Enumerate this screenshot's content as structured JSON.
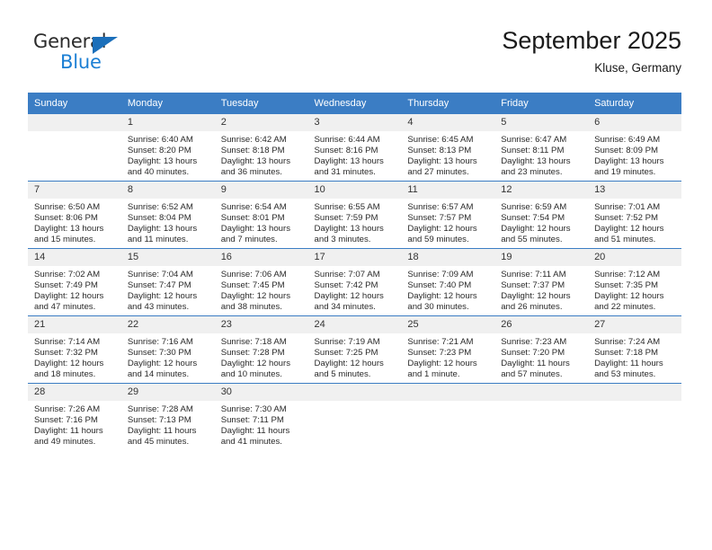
{
  "brand": {
    "name_part1": "General",
    "name_part2": "Blue",
    "accent_color": "#1b7fd4",
    "triangle_color": "#1b6fba"
  },
  "header": {
    "title": "September 2025",
    "subtitle": "Kluse, Germany",
    "header_bg": "#3b7dc4",
    "daynum_bg": "#f0f0f0"
  },
  "weekdays": [
    "Sunday",
    "Monday",
    "Tuesday",
    "Wednesday",
    "Thursday",
    "Friday",
    "Saturday"
  ],
  "labels": {
    "sunrise_prefix": "Sunrise:",
    "sunset_prefix": "Sunset:",
    "daylight_prefix": "Daylight:"
  },
  "weeks": [
    [
      {
        "day": "",
        "blank": true,
        "line1": "",
        "line2": "",
        "line3": "",
        "line4": ""
      },
      {
        "day": "1",
        "line1": "Sunrise: 6:40 AM",
        "line2": "Sunset: 8:20 PM",
        "line3": "Daylight: 13 hours",
        "line4": "and 40 minutes."
      },
      {
        "day": "2",
        "line1": "Sunrise: 6:42 AM",
        "line2": "Sunset: 8:18 PM",
        "line3": "Daylight: 13 hours",
        "line4": "and 36 minutes."
      },
      {
        "day": "3",
        "line1": "Sunrise: 6:44 AM",
        "line2": "Sunset: 8:16 PM",
        "line3": "Daylight: 13 hours",
        "line4": "and 31 minutes."
      },
      {
        "day": "4",
        "line1": "Sunrise: 6:45 AM",
        "line2": "Sunset: 8:13 PM",
        "line3": "Daylight: 13 hours",
        "line4": "and 27 minutes."
      },
      {
        "day": "5",
        "line1": "Sunrise: 6:47 AM",
        "line2": "Sunset: 8:11 PM",
        "line3": "Daylight: 13 hours",
        "line4": "and 23 minutes."
      },
      {
        "day": "6",
        "line1": "Sunrise: 6:49 AM",
        "line2": "Sunset: 8:09 PM",
        "line3": "Daylight: 13 hours",
        "line4": "and 19 minutes."
      }
    ],
    [
      {
        "day": "7",
        "line1": "Sunrise: 6:50 AM",
        "line2": "Sunset: 8:06 PM",
        "line3": "Daylight: 13 hours",
        "line4": "and 15 minutes."
      },
      {
        "day": "8",
        "line1": "Sunrise: 6:52 AM",
        "line2": "Sunset: 8:04 PM",
        "line3": "Daylight: 13 hours",
        "line4": "and 11 minutes."
      },
      {
        "day": "9",
        "line1": "Sunrise: 6:54 AM",
        "line2": "Sunset: 8:01 PM",
        "line3": "Daylight: 13 hours",
        "line4": "and 7 minutes."
      },
      {
        "day": "10",
        "line1": "Sunrise: 6:55 AM",
        "line2": "Sunset: 7:59 PM",
        "line3": "Daylight: 13 hours",
        "line4": "and 3 minutes."
      },
      {
        "day": "11",
        "line1": "Sunrise: 6:57 AM",
        "line2": "Sunset: 7:57 PM",
        "line3": "Daylight: 12 hours",
        "line4": "and 59 minutes."
      },
      {
        "day": "12",
        "line1": "Sunrise: 6:59 AM",
        "line2": "Sunset: 7:54 PM",
        "line3": "Daylight: 12 hours",
        "line4": "and 55 minutes."
      },
      {
        "day": "13",
        "line1": "Sunrise: 7:01 AM",
        "line2": "Sunset: 7:52 PM",
        "line3": "Daylight: 12 hours",
        "line4": "and 51 minutes."
      }
    ],
    [
      {
        "day": "14",
        "line1": "Sunrise: 7:02 AM",
        "line2": "Sunset: 7:49 PM",
        "line3": "Daylight: 12 hours",
        "line4": "and 47 minutes."
      },
      {
        "day": "15",
        "line1": "Sunrise: 7:04 AM",
        "line2": "Sunset: 7:47 PM",
        "line3": "Daylight: 12 hours",
        "line4": "and 43 minutes."
      },
      {
        "day": "16",
        "line1": "Sunrise: 7:06 AM",
        "line2": "Sunset: 7:45 PM",
        "line3": "Daylight: 12 hours",
        "line4": "and 38 minutes."
      },
      {
        "day": "17",
        "line1": "Sunrise: 7:07 AM",
        "line2": "Sunset: 7:42 PM",
        "line3": "Daylight: 12 hours",
        "line4": "and 34 minutes."
      },
      {
        "day": "18",
        "line1": "Sunrise: 7:09 AM",
        "line2": "Sunset: 7:40 PM",
        "line3": "Daylight: 12 hours",
        "line4": "and 30 minutes."
      },
      {
        "day": "19",
        "line1": "Sunrise: 7:11 AM",
        "line2": "Sunset: 7:37 PM",
        "line3": "Daylight: 12 hours",
        "line4": "and 26 minutes."
      },
      {
        "day": "20",
        "line1": "Sunrise: 7:12 AM",
        "line2": "Sunset: 7:35 PM",
        "line3": "Daylight: 12 hours",
        "line4": "and 22 minutes."
      }
    ],
    [
      {
        "day": "21",
        "line1": "Sunrise: 7:14 AM",
        "line2": "Sunset: 7:32 PM",
        "line3": "Daylight: 12 hours",
        "line4": "and 18 minutes."
      },
      {
        "day": "22",
        "line1": "Sunrise: 7:16 AM",
        "line2": "Sunset: 7:30 PM",
        "line3": "Daylight: 12 hours",
        "line4": "and 14 minutes."
      },
      {
        "day": "23",
        "line1": "Sunrise: 7:18 AM",
        "line2": "Sunset: 7:28 PM",
        "line3": "Daylight: 12 hours",
        "line4": "and 10 minutes."
      },
      {
        "day": "24",
        "line1": "Sunrise: 7:19 AM",
        "line2": "Sunset: 7:25 PM",
        "line3": "Daylight: 12 hours",
        "line4": "and 5 minutes."
      },
      {
        "day": "25",
        "line1": "Sunrise: 7:21 AM",
        "line2": "Sunset: 7:23 PM",
        "line3": "Daylight: 12 hours",
        "line4": "and 1 minute."
      },
      {
        "day": "26",
        "line1": "Sunrise: 7:23 AM",
        "line2": "Sunset: 7:20 PM",
        "line3": "Daylight: 11 hours",
        "line4": "and 57 minutes."
      },
      {
        "day": "27",
        "line1": "Sunrise: 7:24 AM",
        "line2": "Sunset: 7:18 PM",
        "line3": "Daylight: 11 hours",
        "line4": "and 53 minutes."
      }
    ],
    [
      {
        "day": "28",
        "line1": "Sunrise: 7:26 AM",
        "line2": "Sunset: 7:16 PM",
        "line3": "Daylight: 11 hours",
        "line4": "and 49 minutes."
      },
      {
        "day": "29",
        "line1": "Sunrise: 7:28 AM",
        "line2": "Sunset: 7:13 PM",
        "line3": "Daylight: 11 hours",
        "line4": "and 45 minutes."
      },
      {
        "day": "30",
        "line1": "Sunrise: 7:30 AM",
        "line2": "Sunset: 7:11 PM",
        "line3": "Daylight: 11 hours",
        "line4": "and 41 minutes."
      },
      {
        "day": "",
        "blank": true,
        "line1": "",
        "line2": "",
        "line3": "",
        "line4": ""
      },
      {
        "day": "",
        "blank": true,
        "line1": "",
        "line2": "",
        "line3": "",
        "line4": ""
      },
      {
        "day": "",
        "blank": true,
        "line1": "",
        "line2": "",
        "line3": "",
        "line4": ""
      },
      {
        "day": "",
        "blank": true,
        "line1": "",
        "line2": "",
        "line3": "",
        "line4": ""
      }
    ]
  ]
}
